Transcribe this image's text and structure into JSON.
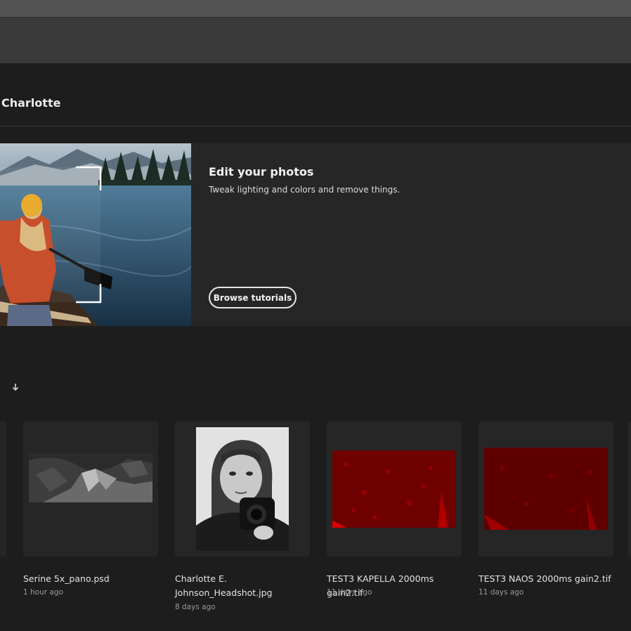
{
  "header": {
    "greeting": "Charlotte"
  },
  "hero": {
    "title": "Edit your photos",
    "subtitle": "Tweak lighting and colors and remove things.",
    "button_label": "Browse tutorials"
  },
  "files": [
    {
      "name": "Serine 5x_pano.psd",
      "time": "1 hour ago"
    },
    {
      "name": "Charlotte E. Johnson_Headshot.jpg",
      "time": "8 days ago"
    },
    {
      "name": "TEST3 KAPELLA 2000ms gain2.tif",
      "time": "11 days ago"
    },
    {
      "name": "TEST3 NAOS 2000ms gain2.tif",
      "time": "11 days ago"
    }
  ],
  "icons": {
    "sort": "arrow-down-icon"
  },
  "colors": {
    "background": "#1d1d1d",
    "card": "#262626",
    "thumb_red": "#8a0000"
  }
}
